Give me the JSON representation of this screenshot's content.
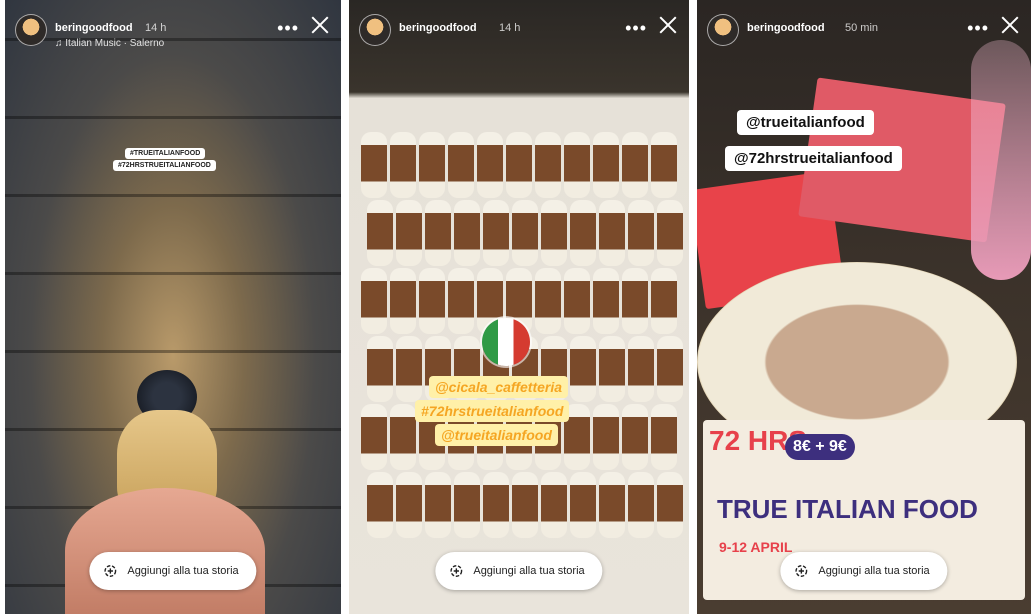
{
  "stories": [
    {
      "username": "beringoodfood",
      "time": "14 h",
      "music": "♫ Italian Music · Salerno",
      "stickers": [
        "#TRUEITALIANFOOD",
        "#72HRSTRUEITALIANFOOD"
      ],
      "add_button": "Aggiungi alla tua storia"
    },
    {
      "username": "beringoodfood",
      "time": "14 h",
      "stickers": [
        "@cicala_caffetteria",
        "#72hrstrueitalianfood",
        "@trueitalianfood"
      ],
      "add_button": "Aggiungi alla tua storia"
    },
    {
      "username": "beringoodfood",
      "time": "50 min",
      "stickers": [
        "@trueitalianfood",
        "@72hrstrueitalianfood"
      ],
      "poster": {
        "hours": "72 HRS",
        "title": "TRUE ITALIAN FOOD",
        "dates": "9-12 APRIL",
        "price": "8€ + 9€"
      },
      "add_button": "Aggiungi alla tua storia"
    }
  ],
  "colors": {
    "tag_yellow": "#f5a623",
    "poster_red": "#e7414b",
    "poster_purple": "#3d2f7e"
  },
  "icons": [
    "more-icon",
    "close-icon",
    "add-story-icon",
    "avatar-icon"
  ]
}
